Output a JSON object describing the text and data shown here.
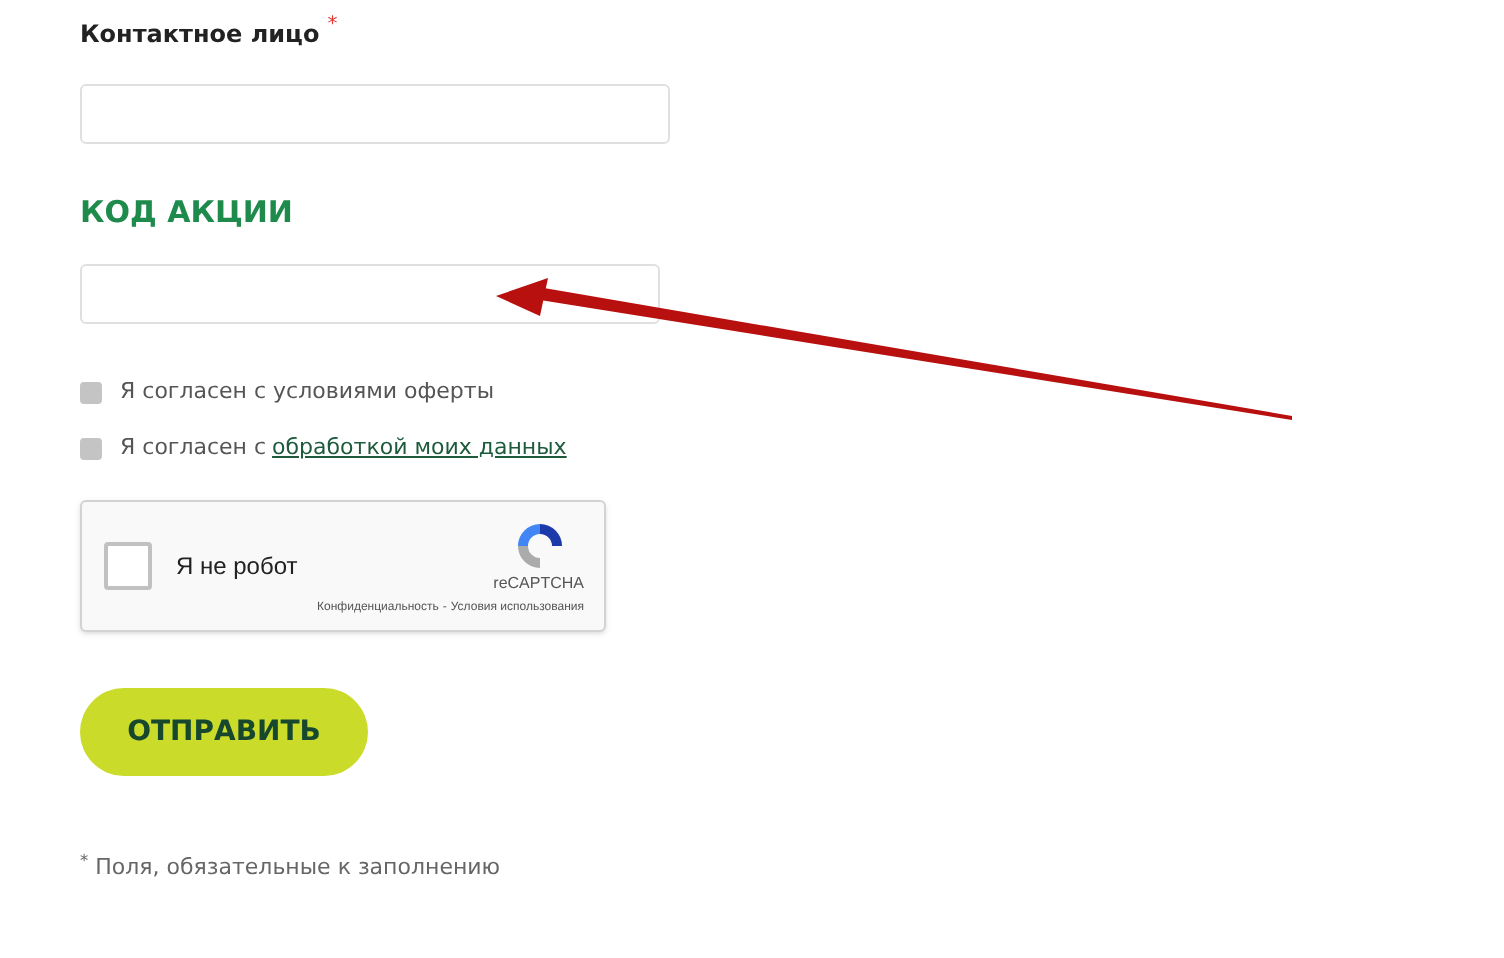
{
  "contact_field": {
    "label": "Контактное лицо",
    "required_mark": "*"
  },
  "promo": {
    "heading": "КОД АКЦИИ"
  },
  "agreements": [
    {
      "text": "Я согласен с условиями оферты",
      "checked": false
    },
    {
      "text": "Я согласен с",
      "link": "обработкой моих данных",
      "checked": false
    }
  ],
  "captcha": {
    "label": "Я не робот",
    "checked": false,
    "brand": "reCAPTCHA",
    "links": [
      "Конфиденциальность",
      "Условия использования"
    ],
    "separator": "-"
  },
  "submit": "ОТПРАВИТЬ",
  "footnote": "$^{*}$ Поля, обязательные к заполнению"
}
